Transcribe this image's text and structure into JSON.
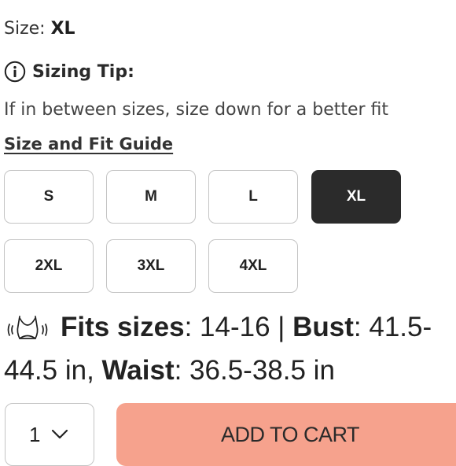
{
  "size": {
    "label": "Size:",
    "value": "XL"
  },
  "sizing_tip": {
    "icon": "info-icon",
    "title": "Sizing Tip:",
    "text": "If in between sizes, size down for a better fit"
  },
  "guide_link": "Size and Fit Guide",
  "size_options": [
    {
      "label": "S",
      "selected": false
    },
    {
      "label": "M",
      "selected": false
    },
    {
      "label": "L",
      "selected": false
    },
    {
      "label": "XL",
      "selected": true
    },
    {
      "label": "2XL",
      "selected": false
    },
    {
      "label": "3XL",
      "selected": false
    },
    {
      "label": "4XL",
      "selected": false
    }
  ],
  "fit_info": {
    "icon": "bra-icon",
    "fits_label": "Fits sizes",
    "fits_value": "14-16",
    "separator": "|",
    "bust_label": "Bust",
    "bust_value": "41.5-44.5 in,",
    "waist_label": "Waist",
    "waist_value": "36.5-38.5 in"
  },
  "quantity": {
    "value": "1"
  },
  "add_to_cart": {
    "label": "ADD TO CART"
  },
  "colors": {
    "selected_bg": "#2b2b2b",
    "cart_bg": "#f6a28d",
    "border": "#c4c4c4"
  }
}
